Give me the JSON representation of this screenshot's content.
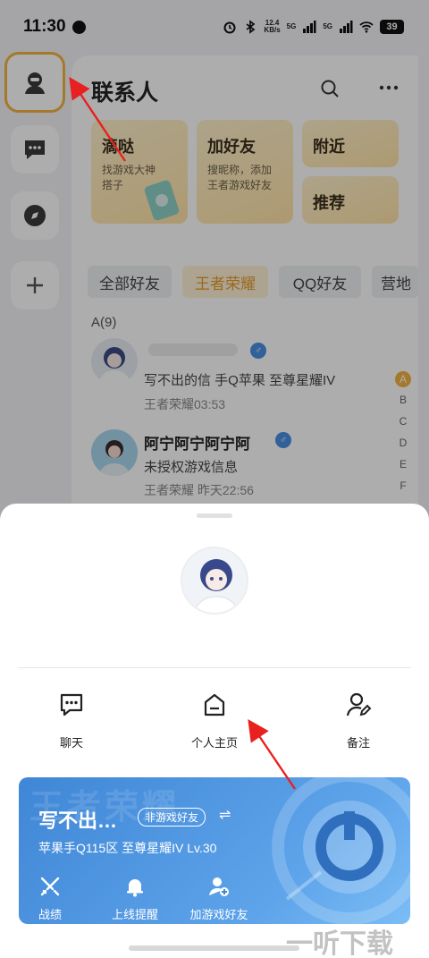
{
  "status_bar": {
    "time": "11:30",
    "speed": "12.4\nKB/s",
    "net1": "5G",
    "net2": "5G",
    "battery": "39",
    "icons": [
      "globe-icon",
      "alarm-icon",
      "bluetooth-icon",
      "signal-icon",
      "wifi-icon",
      "battery-icon"
    ]
  },
  "rail": {
    "items": [
      "contacts-icon",
      "chat-icon",
      "compass-icon",
      "add-icon"
    ],
    "active_color": "#f3b341"
  },
  "contacts": {
    "title": "联系人",
    "cards": [
      {
        "title": "滴哒",
        "subtitle": "找游戏大神\n搭子"
      },
      {
        "title": "加好友",
        "subtitle": "搜昵称，添加\n王者游戏好友"
      },
      {
        "title": "附近",
        "subtitle": ""
      },
      {
        "title": "推荐",
        "subtitle": ""
      }
    ],
    "tabs": [
      "全部好友",
      "王者荣耀",
      "QQ好友",
      "营地"
    ],
    "active_tab": "王者荣耀",
    "section": "A(9)",
    "rows": [
      {
        "name": "",
        "line2": "写不出的信 手Q苹果 至尊星耀IV",
        "line3": "王者荣耀03:53"
      },
      {
        "name": "阿宁阿宁阿宁阿",
        "line2": "未授权游戏信息",
        "line3": "王者荣耀 昨天22:56"
      }
    ],
    "alphabet": [
      "A",
      "B",
      "C",
      "D",
      "E",
      "F"
    ],
    "active_letter": "A"
  },
  "sheet": {
    "actions": [
      {
        "label": "聊天",
        "icon": "chat-bubble-icon"
      },
      {
        "label": "个人主页",
        "icon": "home-icon"
      },
      {
        "label": "备注",
        "icon": "edit-user-icon"
      }
    ],
    "game_card": {
      "watermark": "王者荣耀",
      "name": "写不出…",
      "badge": "非游戏好友",
      "swap": "⇌",
      "info": "苹果手Q115区  至尊星耀IV  Lv.30",
      "actions": [
        {
          "label": "战绩",
          "icon": "swords-icon"
        },
        {
          "label": "上线提醒",
          "icon": "bell-icon"
        },
        {
          "label": "加游戏好友",
          "icon": "add-friend-icon"
        }
      ],
      "accent": "#3f86d6"
    }
  },
  "watermark": "一听下载"
}
